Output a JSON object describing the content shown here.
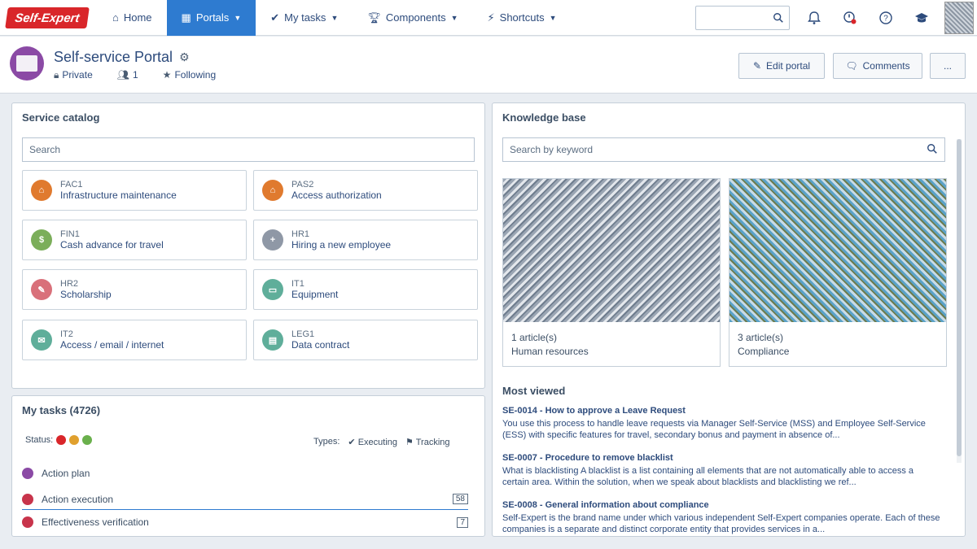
{
  "topnav": {
    "logo": "Self-Expert",
    "items": [
      {
        "label": "Home",
        "icon": "home-icon"
      },
      {
        "label": "Portals",
        "icon": "portal-icon"
      },
      {
        "label": "My tasks",
        "icon": "check-icon"
      },
      {
        "label": "Components",
        "icon": "trophy-icon"
      },
      {
        "label": "Shortcuts",
        "icon": "bolt-icon"
      }
    ]
  },
  "header": {
    "title": "Self-service Portal",
    "visibility": "Private",
    "members": "1",
    "follow": "Following",
    "edit_label": "Edit portal",
    "comments_label": "Comments",
    "more_label": "..."
  },
  "service_catalog": {
    "title": "Service catalog",
    "search_placeholder": "Search",
    "items": [
      {
        "code": "FAC1",
        "name": "Infrastructure maintenance",
        "color": "#e07a2e"
      },
      {
        "code": "PAS2",
        "name": "Access authorization",
        "color": "#e07a2e"
      },
      {
        "code": "FIN1",
        "name": "Cash advance for travel",
        "color": "#7bae5a"
      },
      {
        "code": "HR1",
        "name": "Hiring a new employee",
        "color": "#8f98a6"
      },
      {
        "code": "HR2",
        "name": "Scholarship",
        "color": "#d9707a"
      },
      {
        "code": "IT1",
        "name": "Equipment",
        "color": "#5fae9a"
      },
      {
        "code": "IT2",
        "name": "Access / email / internet",
        "color": "#5fae9a"
      },
      {
        "code": "LEG1",
        "name": "Data contract",
        "color": "#5fae9a"
      }
    ]
  },
  "my_tasks": {
    "title": "My tasks (4726)",
    "status_label": "Status:",
    "status_colors": [
      "#d9262a",
      "#e0a02e",
      "#6ab04c"
    ],
    "types_label": "Types:",
    "filter_executing": "Executing",
    "filter_tracking": "Tracking",
    "rows": [
      {
        "label": "Action plan",
        "badge": ""
      },
      {
        "label": "Action execution",
        "badge": "58"
      },
      {
        "label": "Effectiveness verification",
        "badge": "7"
      }
    ]
  },
  "knowledge_base": {
    "title": "Knowledge base",
    "search_placeholder": "Search by keyword",
    "cards": [
      {
        "count": "1 article(s)",
        "category": "Human resources"
      },
      {
        "count": "3 article(s)",
        "category": "Compliance"
      }
    ],
    "recent_title": "Most viewed",
    "articles": [
      {
        "title": "SE-0014 - How to approve a Leave Request",
        "desc": "You use this process to handle leave requests via Manager Self-Service (MSS) and Employee Self-Service (ESS) with specific features for travel, secondary bonus and payment in absence of..."
      },
      {
        "title": "SE-0007 - Procedure to remove blacklist",
        "desc": "What is blacklisting A blacklist is a list containing all elements that are not automatically able to access a certain area. Within the solution, when we speak about blacklists and blacklisting we ref..."
      },
      {
        "title": "SE-0008 - General information about compliance",
        "desc": "Self-Expert is the brand name under which various independent Self-Expert companies operate. Each of these companies is a separate and distinct corporate entity that provides services in a..."
      }
    ]
  }
}
